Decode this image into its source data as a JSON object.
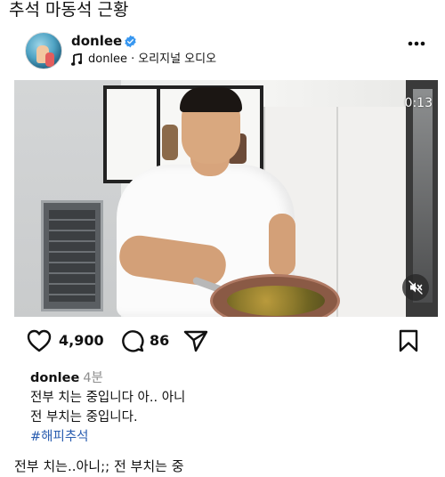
{
  "page": {
    "title": "추석 마동석 근황"
  },
  "post": {
    "username": "donlee",
    "audio": {
      "artist": "donlee",
      "separator": "·",
      "label": "오리지널 오디오"
    },
    "video": {
      "timer": "0:13"
    },
    "actions": {
      "likes": "4,900",
      "comments": "86"
    },
    "caption": {
      "username": "donlee",
      "time": "4분",
      "lines": [
        "전부 치는 중입니다 아.. 아니",
        "전 부치는 중입니다."
      ],
      "hashtag": "#해피추석"
    }
  },
  "footer": {
    "text": "전부 치는..아니;; 전 부치는 중"
  },
  "colors": {
    "verified": "#3897f0",
    "hashtag": "#2a5db0",
    "muted": "#8e8e8e"
  },
  "icons": [
    "verified-icon",
    "music-note-icon",
    "more-icon",
    "mute-icon",
    "heart-icon",
    "comment-icon",
    "share-icon",
    "bookmark-icon"
  ]
}
